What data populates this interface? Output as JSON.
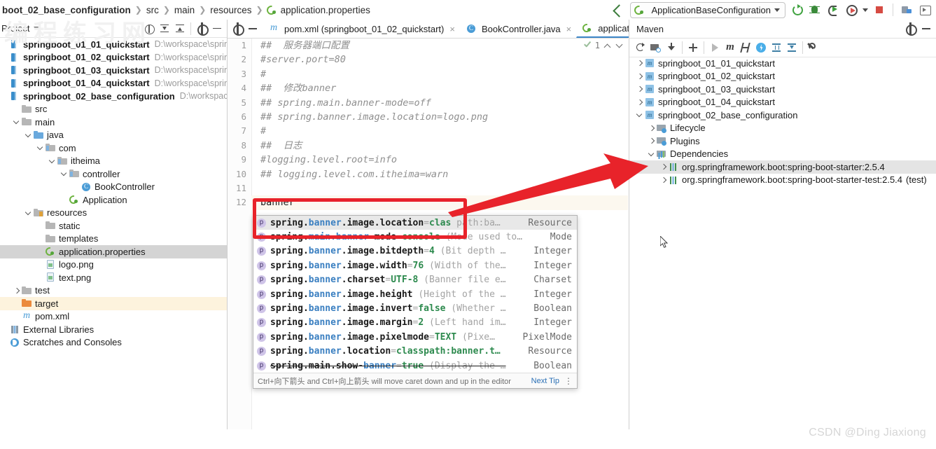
{
  "window": {
    "breadcrumb": [
      "boot_02_base_configuration",
      "src",
      "main",
      "resources",
      "application.properties"
    ],
    "run_configuration": "ApplicationBaseConfiguration",
    "watermark": "CSDN @Ding Jiaxiong"
  },
  "toolbar_icons": {
    "back": "back-arrow-icon",
    "rerun": "rerun-icon",
    "debug": "debug-icon",
    "run_with_coverage": "run-with-coverage-icon",
    "profile": "profile-icon",
    "stop": "stop-icon",
    "layout": "layout-icon",
    "preview": "preview-icon"
  },
  "project_panel": {
    "title": "Project",
    "tools": [
      "locate-icon",
      "expand-all-icon",
      "collapse-all-icon",
      "settings-gear-icon",
      "minimize-icon"
    ],
    "tree": [
      {
        "label": "springboot_01_01_quickstart",
        "path": "D:\\workspace\\springboo",
        "icon": "module-icon",
        "indent": 0,
        "arrow": "none",
        "bold": true,
        "state": "none"
      },
      {
        "label": "springboot_01_02_quickstart",
        "path": "D:\\workspace\\springboo",
        "icon": "module-icon",
        "indent": 0,
        "arrow": "none",
        "bold": true,
        "state": "none"
      },
      {
        "label": "springboot_01_03_quickstart",
        "path": "D:\\workspace\\springboo",
        "icon": "module-icon",
        "indent": 0,
        "arrow": "none",
        "bold": true,
        "state": "none"
      },
      {
        "label": "springboot_01_04_quickstart",
        "path": "D:\\workspace\\springboo",
        "icon": "module-icon",
        "indent": 0,
        "arrow": "none",
        "bold": true,
        "state": "none"
      },
      {
        "label": "springboot_02_base_configuration",
        "path": "D:\\workspace\\sprin",
        "icon": "module-icon",
        "indent": 0,
        "arrow": "none",
        "bold": true,
        "state": "none"
      },
      {
        "label": "src",
        "path": "",
        "icon": "folder-icon",
        "indent": 1,
        "arrow": "none",
        "bold": false,
        "state": "none"
      },
      {
        "label": "main",
        "path": "",
        "icon": "folder-icon",
        "indent": 1,
        "arrow": "down",
        "bold": false,
        "state": "none"
      },
      {
        "label": "java",
        "path": "",
        "icon": "source-folder-icon",
        "indent": 2,
        "arrow": "down",
        "bold": false,
        "state": "none"
      },
      {
        "label": "com",
        "path": "",
        "icon": "package-icon",
        "indent": 3,
        "arrow": "down",
        "bold": false,
        "state": "none"
      },
      {
        "label": "itheima",
        "path": "",
        "icon": "package-icon",
        "indent": 4,
        "arrow": "down",
        "bold": false,
        "state": "none"
      },
      {
        "label": "controller",
        "path": "",
        "icon": "package-icon",
        "indent": 5,
        "arrow": "down",
        "bold": false,
        "state": "none"
      },
      {
        "label": "BookController",
        "path": "",
        "icon": "java-class-icon",
        "indent": 6,
        "arrow": "none",
        "bold": false,
        "state": "none"
      },
      {
        "label": "Application",
        "path": "",
        "icon": "spring-boot-class-icon",
        "indent": 5,
        "arrow": "none",
        "bold": false,
        "state": "none"
      },
      {
        "label": "resources",
        "path": "",
        "icon": "resources-folder-icon",
        "indent": 2,
        "arrow": "down",
        "bold": false,
        "state": "none"
      },
      {
        "label": "static",
        "path": "",
        "icon": "folder-icon",
        "indent": 3,
        "arrow": "none",
        "bold": false,
        "state": "none"
      },
      {
        "label": "templates",
        "path": "",
        "icon": "folder-icon",
        "indent": 3,
        "arrow": "none",
        "bold": false,
        "state": "none"
      },
      {
        "label": "application.properties",
        "path": "",
        "icon": "spring-properties-icon",
        "indent": 3,
        "arrow": "none",
        "bold": false,
        "state": "selected"
      },
      {
        "label": "logo.png",
        "path": "",
        "icon": "image-file-icon",
        "indent": 3,
        "arrow": "none",
        "bold": false,
        "state": "none"
      },
      {
        "label": "text.png",
        "path": "",
        "icon": "image-file-icon",
        "indent": 3,
        "arrow": "none",
        "bold": false,
        "state": "none"
      },
      {
        "label": "test",
        "path": "",
        "icon": "folder-icon",
        "indent": 1,
        "arrow": "right",
        "bold": false,
        "state": "none"
      },
      {
        "label": "target",
        "path": "",
        "icon": "target-folder-icon",
        "indent": 1,
        "arrow": "none",
        "bold": false,
        "state": "highlight"
      },
      {
        "label": "pom.xml",
        "path": "",
        "icon": "maven-file-icon",
        "indent": 1,
        "arrow": "none",
        "bold": false,
        "state": "none"
      },
      {
        "label": "External Libraries",
        "path": "",
        "icon": "external-libraries-icon",
        "indent": 0,
        "arrow": "none",
        "bold": false,
        "state": "none"
      },
      {
        "label": "Scratches and Consoles",
        "path": "",
        "icon": "scratches-icon",
        "indent": 0,
        "arrow": "none",
        "bold": false,
        "state": "none"
      }
    ]
  },
  "editor": {
    "tabs": [
      {
        "label": "pom.xml (springboot_01_02_quickstart)",
        "icon": "maven-file-icon",
        "active": false,
        "close": "×"
      },
      {
        "label": "BookController.java",
        "icon": "java-class-icon",
        "active": false,
        "close": "×"
      },
      {
        "label": "application.properties",
        "icon": "spring-properties-icon",
        "active": true,
        "close": "×"
      }
    ],
    "inspection_count": "1",
    "lines": [
      {
        "n": "1",
        "text": "##  服务器端口配置",
        "comment": true
      },
      {
        "n": "2",
        "text": "#server.port=80",
        "comment": true
      },
      {
        "n": "3",
        "text": "#",
        "comment": true
      },
      {
        "n": "4",
        "text": "##  修改banner",
        "comment": true
      },
      {
        "n": "5",
        "text": "## spring.main.banner-mode=off",
        "comment": true
      },
      {
        "n": "6",
        "text": "## spring.banner.image.location=logo.png",
        "comment": true
      },
      {
        "n": "7",
        "text": "#",
        "comment": true
      },
      {
        "n": "8",
        "text": "##  日志",
        "comment": true
      },
      {
        "n": "9",
        "text": "#logging.level.root=info",
        "comment": true
      },
      {
        "n": "10",
        "text": "## logging.level.com.itheima=warn",
        "comment": true
      },
      {
        "n": "11",
        "text": "",
        "comment": true
      },
      {
        "n": "12",
        "text": "banner",
        "comment": false
      }
    ]
  },
  "completion_popup": {
    "items": [
      {
        "root": "spring.",
        "match": "banner",
        "rest": ".image.location",
        "eq": "=",
        "value": "clas",
        "desc": "path:ba…",
        "type": "Resource",
        "selected": true,
        "struck": false
      },
      {
        "root": "spring.",
        "match": "main.banner",
        "rest": "-mode",
        "eq": "=",
        "value": "console",
        "desc": "(Mode used to…",
        "type": "Mode",
        "selected": false,
        "struck": false
      },
      {
        "root": "spring.",
        "match": "banner",
        "rest": ".image.bitdepth",
        "eq": "=",
        "value": "4",
        "desc": "(Bit depth …",
        "type": "Integer",
        "selected": false,
        "struck": false
      },
      {
        "root": "spring.",
        "match": "banner",
        "rest": ".image.width",
        "eq": "=",
        "value": "76",
        "desc": "(Width of the…",
        "type": "Integer",
        "selected": false,
        "struck": false
      },
      {
        "root": "spring.",
        "match": "banner",
        "rest": ".charset",
        "eq": "=",
        "value": "UTF-8",
        "desc": "(Banner file e…",
        "type": "Charset",
        "selected": false,
        "struck": false
      },
      {
        "root": "spring.",
        "match": "banner",
        "rest": ".image.height",
        "eq": "",
        "value": "",
        "desc": "(Height of the …",
        "type": "Integer",
        "selected": false,
        "struck": false
      },
      {
        "root": "spring.",
        "match": "banner",
        "rest": ".image.invert",
        "eq": "=",
        "value": "false",
        "desc": "(Whether …",
        "type": "Boolean",
        "selected": false,
        "struck": false
      },
      {
        "root": "spring.",
        "match": "banner",
        "rest": ".image.margin",
        "eq": "=",
        "value": "2",
        "desc": "(Left hand im…",
        "type": "Integer",
        "selected": false,
        "struck": false
      },
      {
        "root": "spring.",
        "match": "banner",
        "rest": ".image.pixelmode",
        "eq": "=",
        "value": "TEXT",
        "desc": "(Pixe…",
        "type": "PixelMode",
        "selected": false,
        "struck": false
      },
      {
        "root": "spring.",
        "match": "banner",
        "rest": ".location",
        "eq": "=",
        "value": "classpath:banner.t…",
        "desc": "",
        "type": "Resource",
        "selected": false,
        "struck": false
      },
      {
        "root": "spring.main.show-",
        "match": "banner",
        "rest": "",
        "eq": "=",
        "value": "true",
        "desc": "(Display the …",
        "type": "Boolean",
        "selected": false,
        "struck": true
      }
    ],
    "hint_text": "Ctrl+向下箭头 and Ctrl+向上箭头 will move caret down and up in the editor",
    "hint_link": "Next Tip"
  },
  "maven_panel": {
    "title": "Maven",
    "head_tools": [
      "settings-gear-icon",
      "minimize-icon"
    ],
    "toolbar_icons": [
      "refresh-icon",
      "add-maven-project-icon",
      "download-sources-icon",
      "add-icon",
      "run-icon",
      "execute-maven-goal-icon",
      "toggle-skip-tests-icon",
      "toggle-offline-mode-icon",
      "expand-all-icon",
      "collapse-all-icon",
      "settings-wrench-icon"
    ],
    "tree": [
      {
        "label": "springboot_01_01_quickstart",
        "icon": "maven-module-icon",
        "indent": 0,
        "arrow": "right",
        "state": "none",
        "scope": ""
      },
      {
        "label": "springboot_01_02_quickstart",
        "icon": "maven-module-icon",
        "indent": 0,
        "arrow": "right",
        "state": "none",
        "scope": ""
      },
      {
        "label": "springboot_01_03_quickstart",
        "icon": "maven-module-icon",
        "indent": 0,
        "arrow": "right",
        "state": "none",
        "scope": ""
      },
      {
        "label": "springboot_01_04_quickstart",
        "icon": "maven-module-icon",
        "indent": 0,
        "arrow": "right",
        "state": "none",
        "scope": ""
      },
      {
        "label": "springboot_02_base_configuration",
        "icon": "maven-module-icon",
        "indent": 0,
        "arrow": "down",
        "state": "none",
        "scope": ""
      },
      {
        "label": "Lifecycle",
        "icon": "lifecycle-folder-icon",
        "indent": 1,
        "arrow": "right",
        "state": "none",
        "scope": ""
      },
      {
        "label": "Plugins",
        "icon": "plugins-folder-icon",
        "indent": 1,
        "arrow": "right",
        "state": "none",
        "scope": ""
      },
      {
        "label": "Dependencies",
        "icon": "dependencies-folder-icon",
        "indent": 1,
        "arrow": "down",
        "state": "none",
        "scope": ""
      },
      {
        "label": "org.springframework.boot:spring-boot-starter:2.5.4",
        "icon": "dependency-icon",
        "indent": 2,
        "arrow": "right",
        "state": "selected",
        "scope": ""
      },
      {
        "label": "org.springframework.boot:spring-boot-starter-test:2.5.4",
        "icon": "dependency-icon",
        "indent": 2,
        "arrow": "right",
        "state": "none",
        "scope": "(test)"
      }
    ]
  },
  "annotations": {
    "highlight_box_color": "#e8232a",
    "arrow_color": "#e8232a",
    "arrow_label": "points from highlighted completion entry to spring-boot-starter dependency"
  }
}
